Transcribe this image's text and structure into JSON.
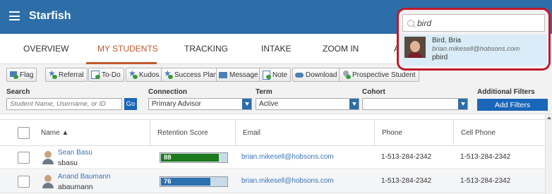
{
  "app": {
    "title": "Starfish"
  },
  "tabs": [
    {
      "label": "OVERVIEW",
      "active": false
    },
    {
      "label": "MY STUDENTS",
      "active": true
    },
    {
      "label": "TRACKING",
      "active": false
    },
    {
      "label": "INTAKE",
      "active": false
    },
    {
      "label": "ZOOM IN",
      "active": false
    },
    {
      "label": "A",
      "active": false
    }
  ],
  "actions": [
    {
      "label": "Flag",
      "icon": "flag-icon"
    },
    {
      "label": "Referral",
      "icon": "referral-icon"
    },
    {
      "label": "To-Do",
      "icon": "todo-icon"
    },
    {
      "label": "Kudos",
      "icon": "kudos-icon"
    },
    {
      "label": "Success Plan",
      "icon": "success-plan-icon"
    },
    {
      "label": "Message",
      "icon": "envelope-icon"
    },
    {
      "label": "Note",
      "icon": "note-icon"
    },
    {
      "label": "Download",
      "icon": "cloud-download-icon"
    },
    {
      "label": "Prospective Student",
      "icon": "prospective-student-icon"
    }
  ],
  "filters": {
    "search_label": "Search",
    "search_placeholder": "Student Name, Username, or ID",
    "go_label": "Go",
    "connection_label": "Connection",
    "connection_value": "Primary Advisor",
    "term_label": "Term",
    "term_value": "Active",
    "cohort_label": "Cohort",
    "cohort_value": "",
    "additional_label": "Additional Filters",
    "add_button": "Add Filters"
  },
  "table": {
    "columns": [
      "Name ▲",
      "Retention Score",
      "Email",
      "Phone",
      "Cell Phone"
    ],
    "rows": [
      {
        "name": "Sean Basu",
        "username": "sbasu",
        "score": "88",
        "score_pct": 88,
        "score_color": "#1c7a1c",
        "email": "brian.mikesell@hobsons.com",
        "phone": "1-513-284-2342",
        "cell": "1-513-284-2342"
      },
      {
        "name": "Anand Baumann",
        "username": "abaumann",
        "score": "76",
        "score_pct": 76,
        "score_color": "#2e6fb0",
        "email": "brian.mikesell@hobsons.com",
        "phone": "1-513-284-2342",
        "cell": "1-513-284-2342"
      }
    ]
  },
  "search_popup": {
    "query": "bird",
    "result": {
      "name": "Bird, Bria",
      "email": "brian.mikesell@hobsons.com",
      "username": "pbird"
    }
  },
  "colors": {
    "brand": "#2d6ea8",
    "active_tab": "#c1572a",
    "highlight_border": "#c0192a"
  }
}
